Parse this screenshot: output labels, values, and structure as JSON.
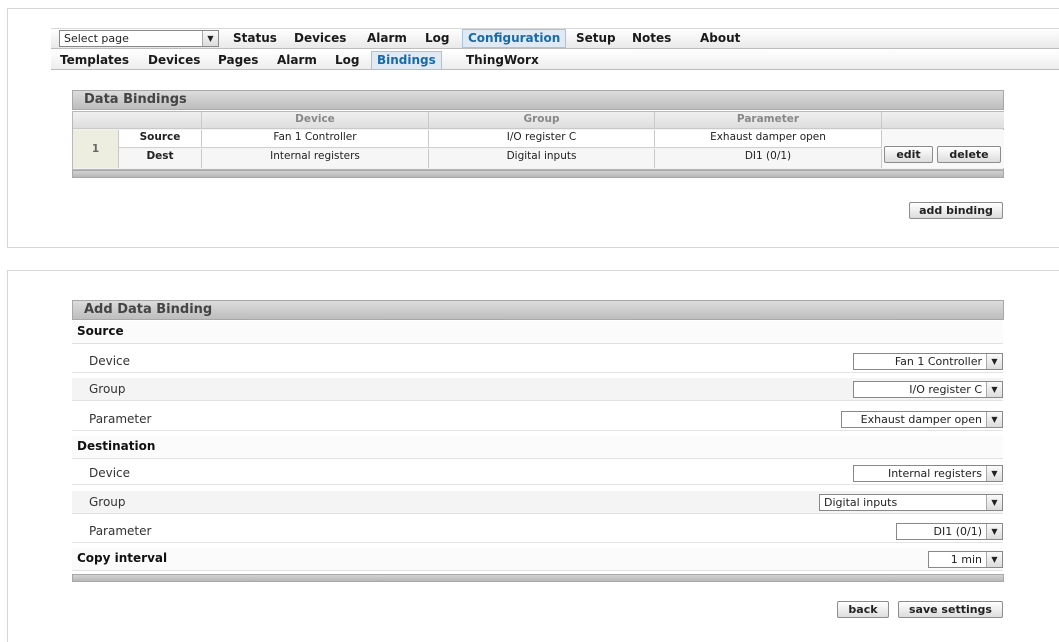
{
  "nav": {
    "select_page": "Select page",
    "items": [
      "Status",
      "Devices",
      "Alarm",
      "Log",
      "Configuration",
      "Setup",
      "Notes",
      "About"
    ],
    "sub_items": [
      "Templates",
      "Devices",
      "Pages",
      "Alarm",
      "Log",
      "Bindings",
      "ThingWorx"
    ]
  },
  "bindings": {
    "title": "Data Bindings",
    "columns": [
      "Device",
      "Group",
      "Parameter"
    ],
    "rows": [
      {
        "index": "1",
        "source": {
          "label": "Source",
          "device": "Fan 1 Controller",
          "group": "I/O register C",
          "parameter": "Exhaust damper open"
        },
        "dest": {
          "label": "Dest",
          "device": "Internal registers",
          "group": "Digital inputs",
          "parameter": "DI1 (0/1)"
        }
      }
    ],
    "edit_label": "edit",
    "delete_label": "delete",
    "add_label": "add binding"
  },
  "form": {
    "title": "Add Data Binding",
    "source_heading": "Source",
    "dest_heading": "Destination",
    "device_label": "Device",
    "group_label": "Group",
    "parameter_label": "Parameter",
    "source": {
      "device": "Fan 1 Controller",
      "group": "I/O register C",
      "parameter": "Exhaust damper open"
    },
    "dest": {
      "device": "Internal registers",
      "group": "Digital inputs",
      "parameter": "DI1 (0/1)"
    },
    "interval_label": "Copy interval",
    "interval": "1 min",
    "back_label": "back",
    "save_label": "save settings"
  }
}
